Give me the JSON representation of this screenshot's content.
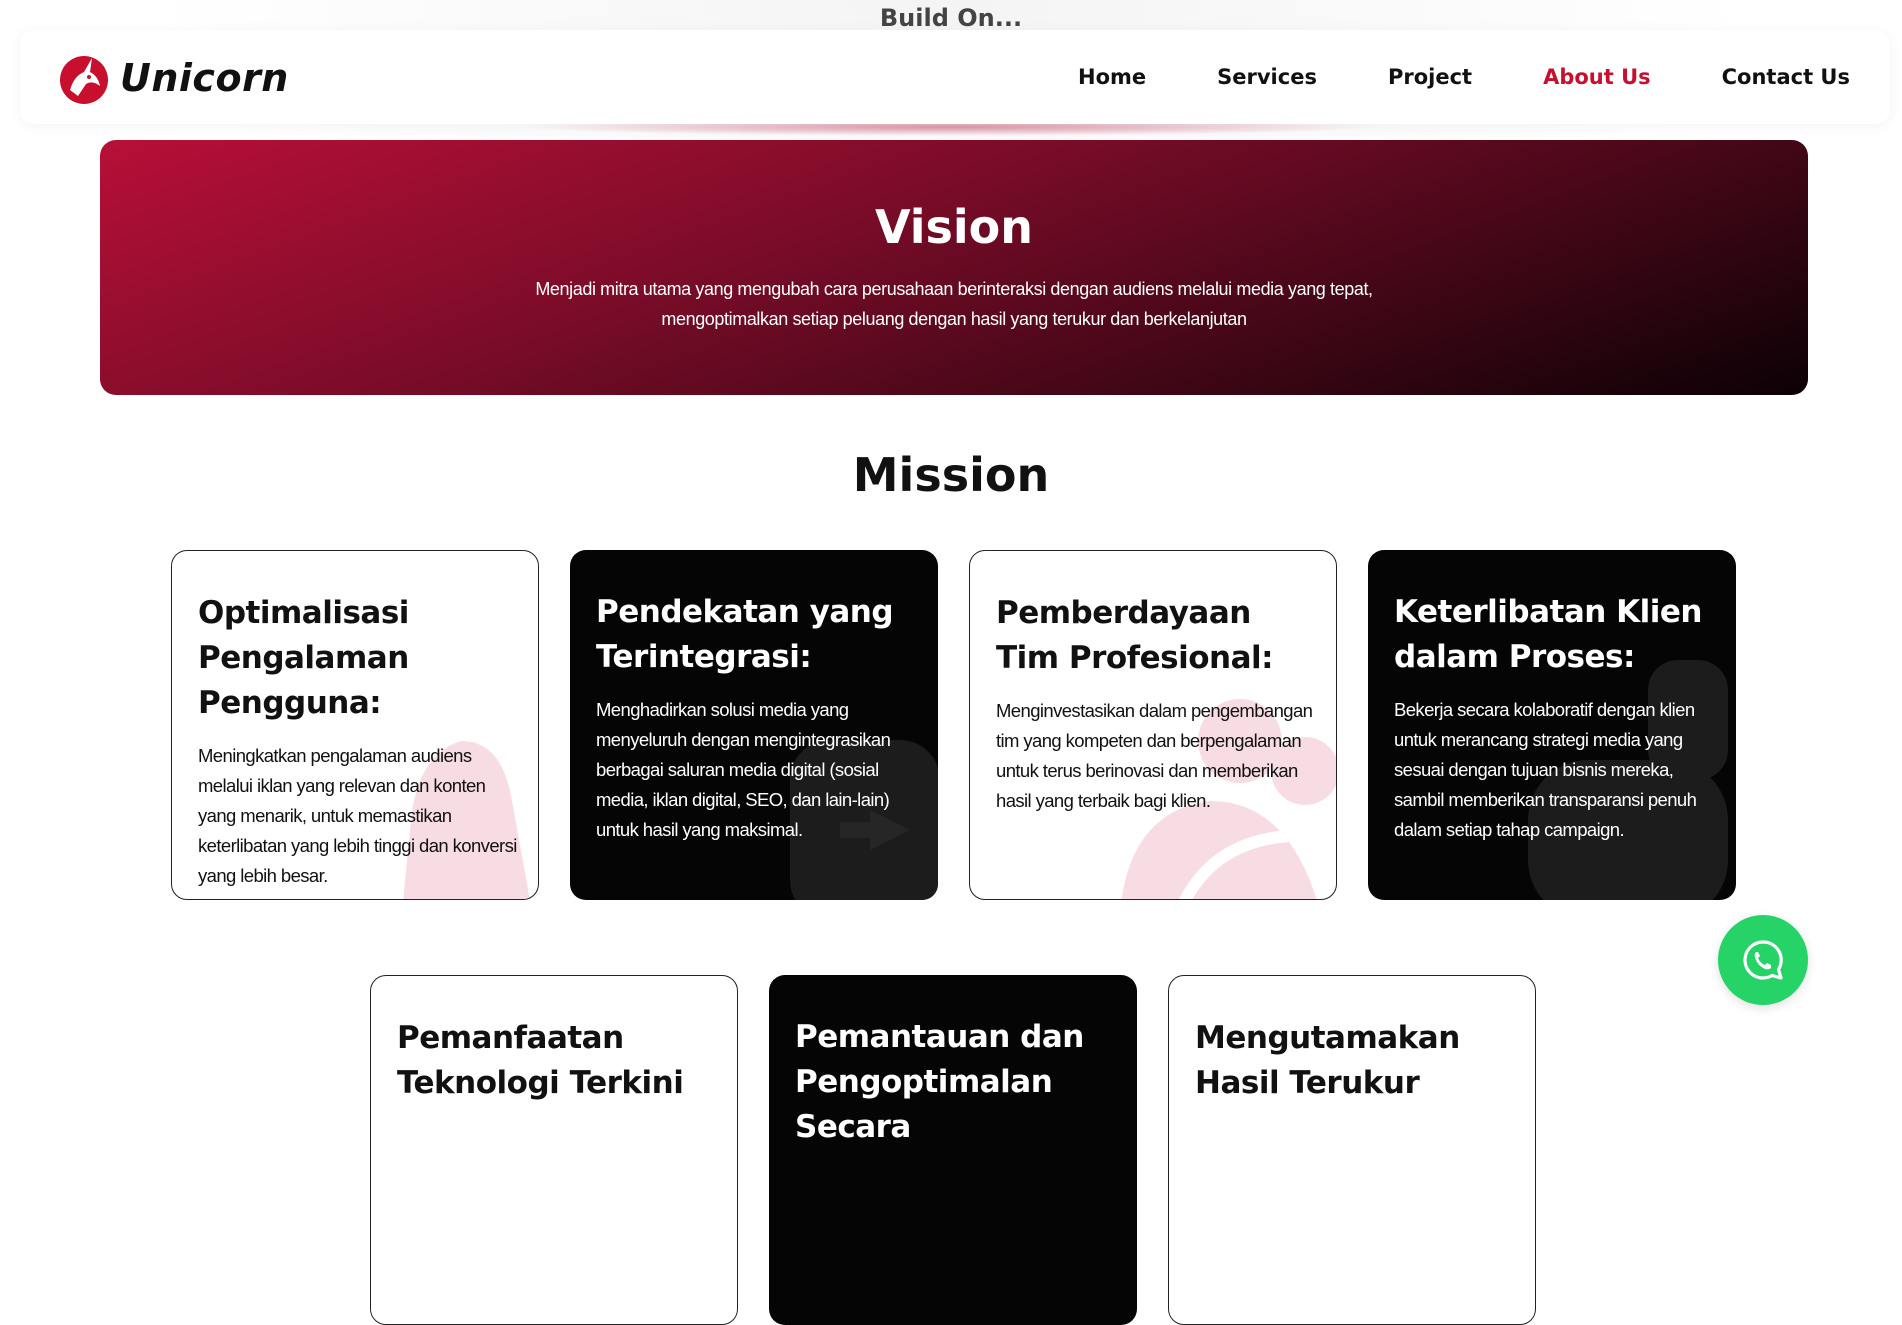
{
  "top_banner": "Build On...",
  "brand": {
    "name": "Unicorn",
    "accent": "#c8102e"
  },
  "nav": {
    "items": [
      {
        "label": "Home",
        "active": false
      },
      {
        "label": "Services",
        "active": false
      },
      {
        "label": "Project",
        "active": false
      },
      {
        "label": "About Us",
        "active": true
      },
      {
        "label": "Contact Us",
        "active": false
      }
    ]
  },
  "vision": {
    "title": "Vision",
    "text": "Menjadi mitra utama yang mengubah cara perusahaan berinteraksi dengan audiens melalui media yang tepat, mengoptimalkan setiap peluang dengan hasil yang terukur dan berkelanjutan"
  },
  "mission": {
    "title": "Mission",
    "cards": [
      {
        "title": "Optimalisasi Pengalaman Pengguna:",
        "text": "Meningkatkan pengalaman audiens melalui iklan yang relevan dan konten yang menarik, untuk memastikan keterlibatan yang lebih tinggi dan konversi yang lebih besar.",
        "theme": "light"
      },
      {
        "title": "Pendekatan yang Terintegrasi:",
        "text": "Menghadirkan solusi media yang menyeluruh dengan mengintegrasikan berbagai saluran media digital (sosial media, iklan digital, SEO, dan lain-lain) untuk hasil yang maksimal.",
        "theme": "dark"
      },
      {
        "title": "Pemberdayaan Tim Profesional:",
        "text": "Menginvestasikan dalam pengembangan tim yang kompeten dan berpengalaman untuk terus berinovasi dan memberikan hasil yang terbaik bagi klien.",
        "theme": "light"
      },
      {
        "title": "Keterlibatan Klien dalam Proses:",
        "text": "Bekerja secara kolaboratif dengan klien untuk merancang strategi media yang sesuai dengan tujuan bisnis mereka, sambil memberikan transparansi penuh dalam setiap tahap campaign.",
        "theme": "dark"
      },
      {
        "title": "Pemanfaatan Teknologi Terkini",
        "text": "",
        "theme": "light"
      },
      {
        "title": "Pemantauan dan Pengoptimalan Secara",
        "text": "",
        "theme": "dark"
      },
      {
        "title": "Mengutamakan Hasil Terukur",
        "text": "",
        "theme": "light"
      }
    ]
  },
  "whatsapp": {
    "icon": "whatsapp-icon",
    "color": "#25d366"
  }
}
